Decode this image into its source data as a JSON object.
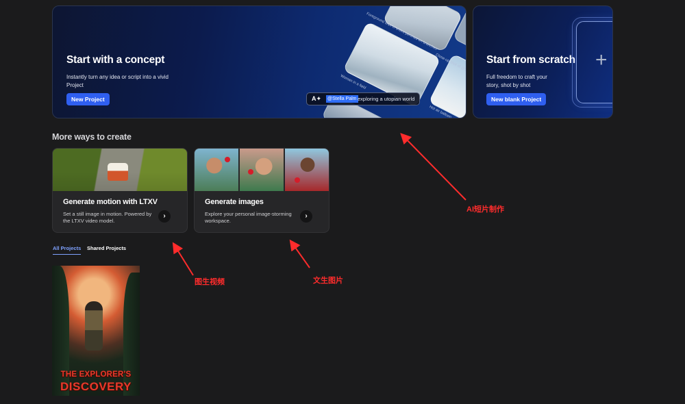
{
  "concept_card": {
    "title": "Start with a concept",
    "description": "Instantly turn any idea or script into a vivid Project",
    "button_label": "New Project",
    "captions": {
      "tile_a": "Foreground shot of a bird perched on branches",
      "tile_b": "Close-up shot of @Stella Palm",
      "tile_c": "Woman in a field",
      "tile_d": "Hot air balloon"
    },
    "prompt": {
      "icon": "A✦",
      "mention": "@Stella Palm",
      "text": "exploring a utopian world"
    }
  },
  "scratch_card": {
    "title": "Start from scratch",
    "description": "Full freedom to craft your story, shot by shot",
    "button_label": "New blank Project",
    "plus_glyph": "+"
  },
  "more_ways": {
    "heading": "More ways to create",
    "cards": [
      {
        "title": "Generate motion with LTXV",
        "description": "Set a still image in motion. Powered by the LTXV video model.",
        "chevron": "›"
      },
      {
        "title": "Generate images",
        "description": "Explore your personal image-storming workspace.",
        "chevron": "›"
      }
    ]
  },
  "tabs": {
    "all": "All Projects",
    "shared": "Shared Projects"
  },
  "projects": [
    {
      "title_line1": "THE EXPLORER'S",
      "title_line2": "DISCOVERY"
    }
  ],
  "annotations": {
    "ai_short_film": "AI短片制作",
    "image_to_video": "图生视频",
    "text_to_image": "文生图片",
    "color": "#ff2c2c"
  },
  "colors": {
    "background": "#1b1b1c",
    "accent_blue": "#2f5ff0",
    "tab_active": "#7fa2ff",
    "card_bg": "#262628"
  }
}
